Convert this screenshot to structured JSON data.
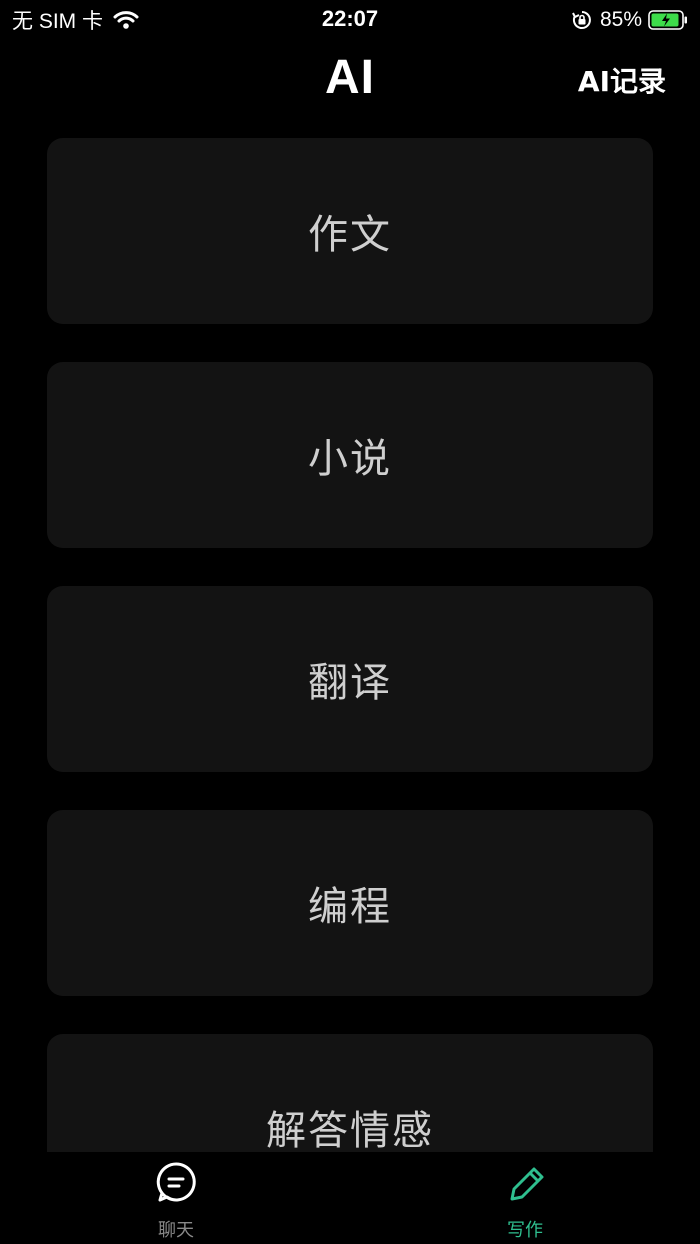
{
  "status_bar": {
    "carrier": "无 SIM 卡",
    "time": "22:07",
    "battery": "85%"
  },
  "nav": {
    "title": "AI",
    "action": "AI记录"
  },
  "cards": [
    {
      "label": "作文"
    },
    {
      "label": "小说"
    },
    {
      "label": "翻译"
    },
    {
      "label": "编程"
    },
    {
      "label": "解答情感"
    }
  ],
  "tabs": [
    {
      "label": "聊天",
      "icon": "chat-bubble-icon",
      "active": false
    },
    {
      "label": "写作",
      "icon": "pencil-icon",
      "active": true
    }
  ],
  "colors": {
    "background": "#000000",
    "card": "#131313",
    "card_text": "#cfcfcf",
    "accent": "#2fbf8f",
    "inactive": "#8a8a8a",
    "battery": "#3ddc4a"
  }
}
